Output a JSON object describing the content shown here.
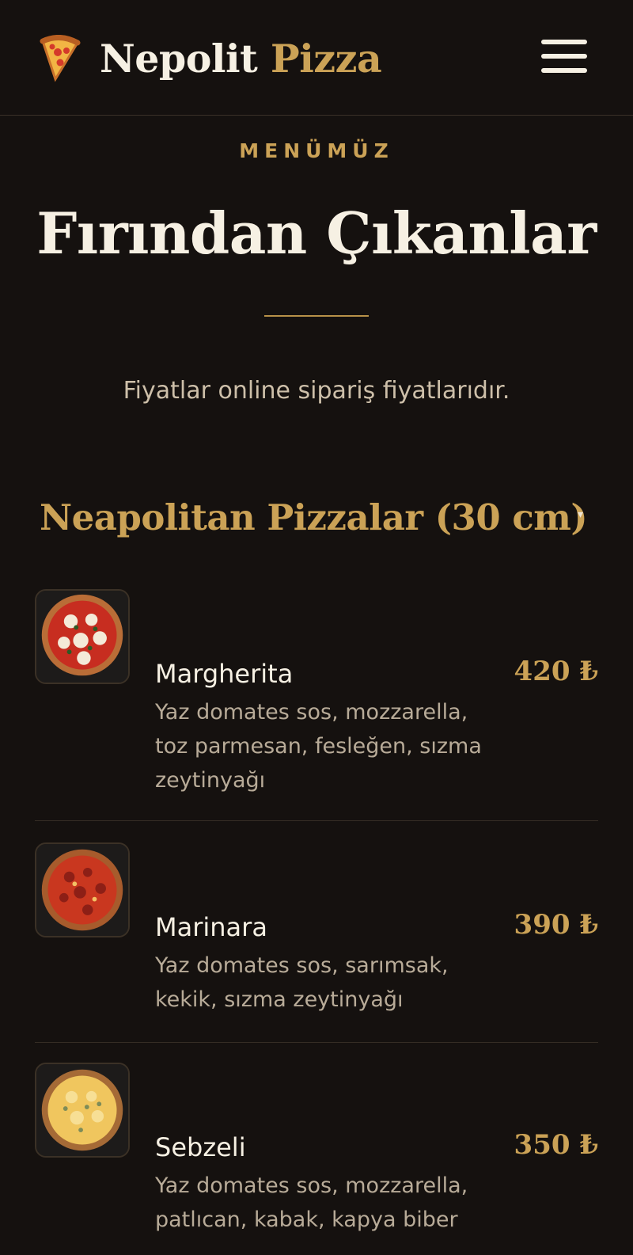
{
  "header": {
    "logo_icon": "pizza-slice-icon",
    "brand_first": "Nepolit",
    "brand_second": "Pizza",
    "menu_icon": "hamburger-menu-icon"
  },
  "intro": {
    "eyebrow": "MENÜMÜZ",
    "title": "Fırından Çıkanlar",
    "note": "Fiyatlar online sipariş fiyatlarıdır."
  },
  "category": {
    "title": "Neapolitan Pizzalar (30 cm)",
    "caret": "▾"
  },
  "items": [
    {
      "name": "Margherita",
      "price": "420 ₺",
      "desc": "Yaz domates sos, mozzarella, toz parmesan, fesleğen, sızma zeytinyağı"
    },
    {
      "name": "Marinara",
      "price": "390 ₺",
      "desc": "Yaz domates sos, sarımsak, kekik, sızma zeytinyağı"
    },
    {
      "name": "Sebzeli",
      "price": "350 ₺",
      "desc": "Yaz domates sos, mozzarella, patlıcan, kabak, kapya biber"
    }
  ],
  "colors": {
    "background": "#15110f",
    "accent": "#cba256",
    "text": "#f6f0e3",
    "muted": "#b8ab98"
  }
}
